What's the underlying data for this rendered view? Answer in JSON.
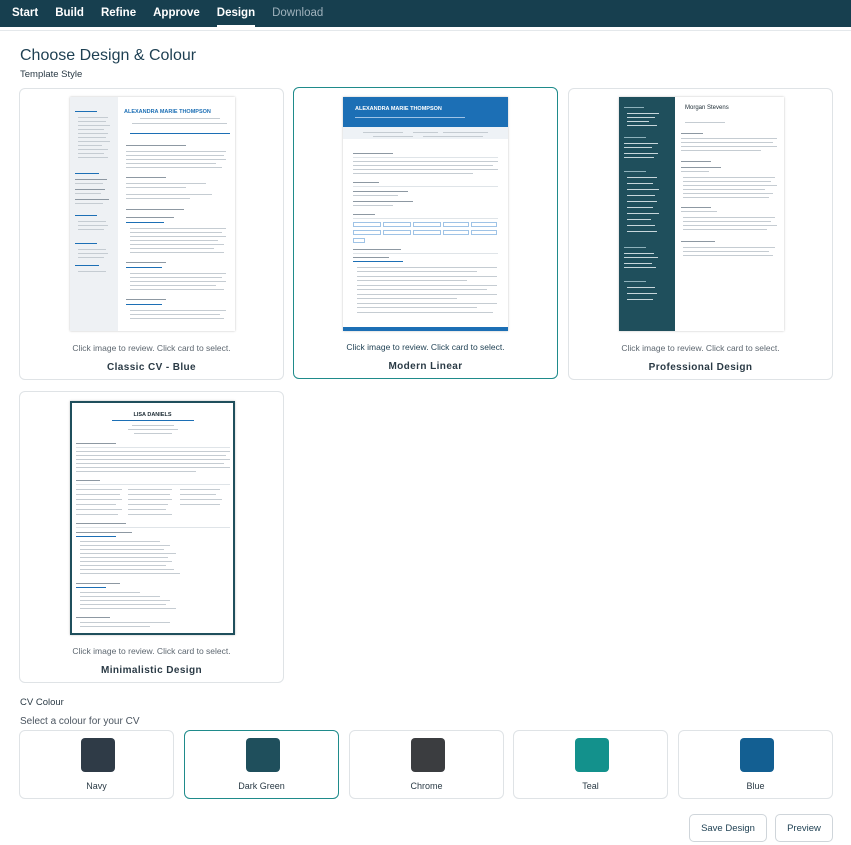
{
  "nav": {
    "tabs": [
      {
        "label": "Start"
      },
      {
        "label": "Build"
      },
      {
        "label": "Refine"
      },
      {
        "label": "Approve"
      },
      {
        "label": "Design"
      },
      {
        "label": "Download"
      }
    ],
    "active_tab": "Design"
  },
  "page": {
    "title": "Choose Design & Colour",
    "template_style_label": "Template Style",
    "cv_colour_label": "CV Colour",
    "colour_prompt": "Select a colour for your CV"
  },
  "templates": [
    {
      "name": "Classic CV - Blue",
      "hint": "Click image to review. Click card to select.",
      "preview_name": "ALEXANDRA MARIE THOMPSON",
      "selected": false
    },
    {
      "name": "Modern Linear",
      "hint": "Click image to review. Click card to select.",
      "preview_name": "ALEXANDRA MARIE THOMPSON",
      "selected": true
    },
    {
      "name": "Professional Design",
      "hint": "Click image to review. Click card to select.",
      "preview_name": "Morgan Stevens",
      "selected": false
    },
    {
      "name": "Minimalistic Design",
      "hint": "Click image to review. Click card to select.",
      "preview_name": "LISA DANIELS",
      "selected": false
    }
  ],
  "colours": [
    {
      "name": "Navy",
      "hex": "#2f3b47",
      "selected": false
    },
    {
      "name": "Dark Green",
      "hex": "#1f4f5c",
      "selected": true
    },
    {
      "name": "Chrome",
      "hex": "#3b3d40",
      "selected": false
    },
    {
      "name": "Teal",
      "hex": "#13918c",
      "selected": false
    },
    {
      "name": "Blue",
      "hex": "#135f92",
      "selected": false
    }
  ],
  "buttons": {
    "save": "Save Design",
    "preview": "Preview"
  },
  "accent_color": "#1f8b8b",
  "nav_color": "#173f4f"
}
